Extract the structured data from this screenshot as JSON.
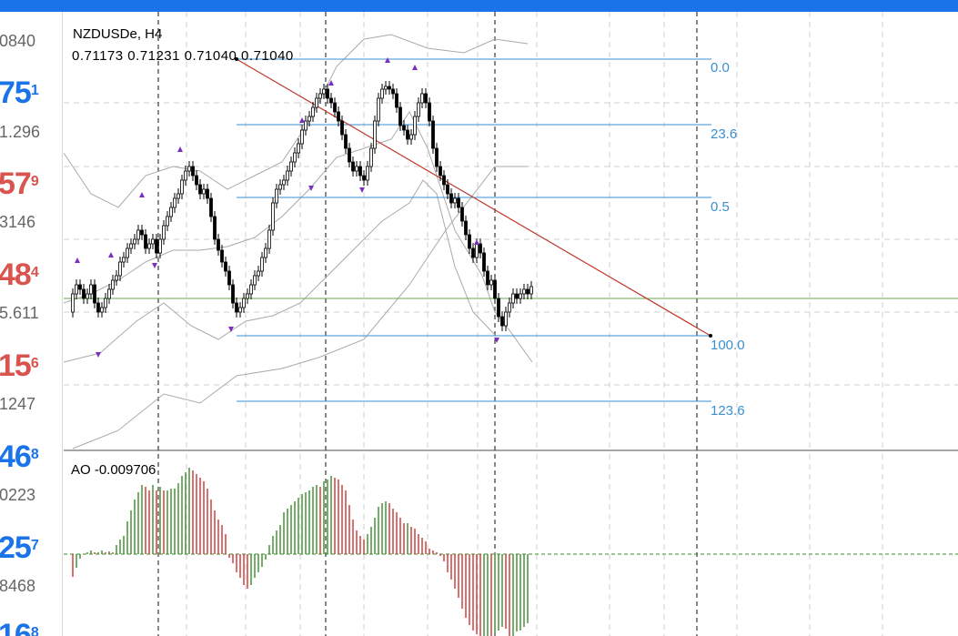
{
  "quotes_panel": {
    "rows": [
      {
        "small": "0840"
      },
      {
        "big": "75",
        "sup": "1",
        "color": "blue",
        "small": "1.296"
      },
      {
        "big": "57",
        "sup": "9",
        "color": "red",
        "small": "3146"
      },
      {
        "big": "48",
        "sup": "4",
        "color": "red",
        "small": "5.611"
      },
      {
        "big": "15",
        "sup": "6",
        "color": "red",
        "small": "1247"
      },
      {
        "big": "46",
        "sup": "8",
        "color": "blue",
        "small": "0223"
      },
      {
        "big": "25",
        "sup": "7",
        "color": "blue",
        "small": "8468"
      },
      {
        "big": "16",
        "sup": "8",
        "color": "blue"
      }
    ]
  },
  "chart": {
    "symbol": "NZDUSDe, H4",
    "ohlc": "0.71173 0.71231 0.71040 0.71040",
    "fibonacci_levels": [
      "0.0",
      "23.6",
      "0.5",
      "100.0",
      "123.6"
    ],
    "indicator_label": "AO -0.009706",
    "colors": {
      "accent": "#1a73e8",
      "up_quote": "#1a73e8",
      "down_quote": "#d9534f",
      "fib_lines": "#3a8fd0",
      "trendline": "#c0392b",
      "horizontal_line": "#6aa84f",
      "ao_up": "#3a8a2a",
      "ao_down": "#cc3333",
      "markers": "#7b2fbe"
    }
  }
}
